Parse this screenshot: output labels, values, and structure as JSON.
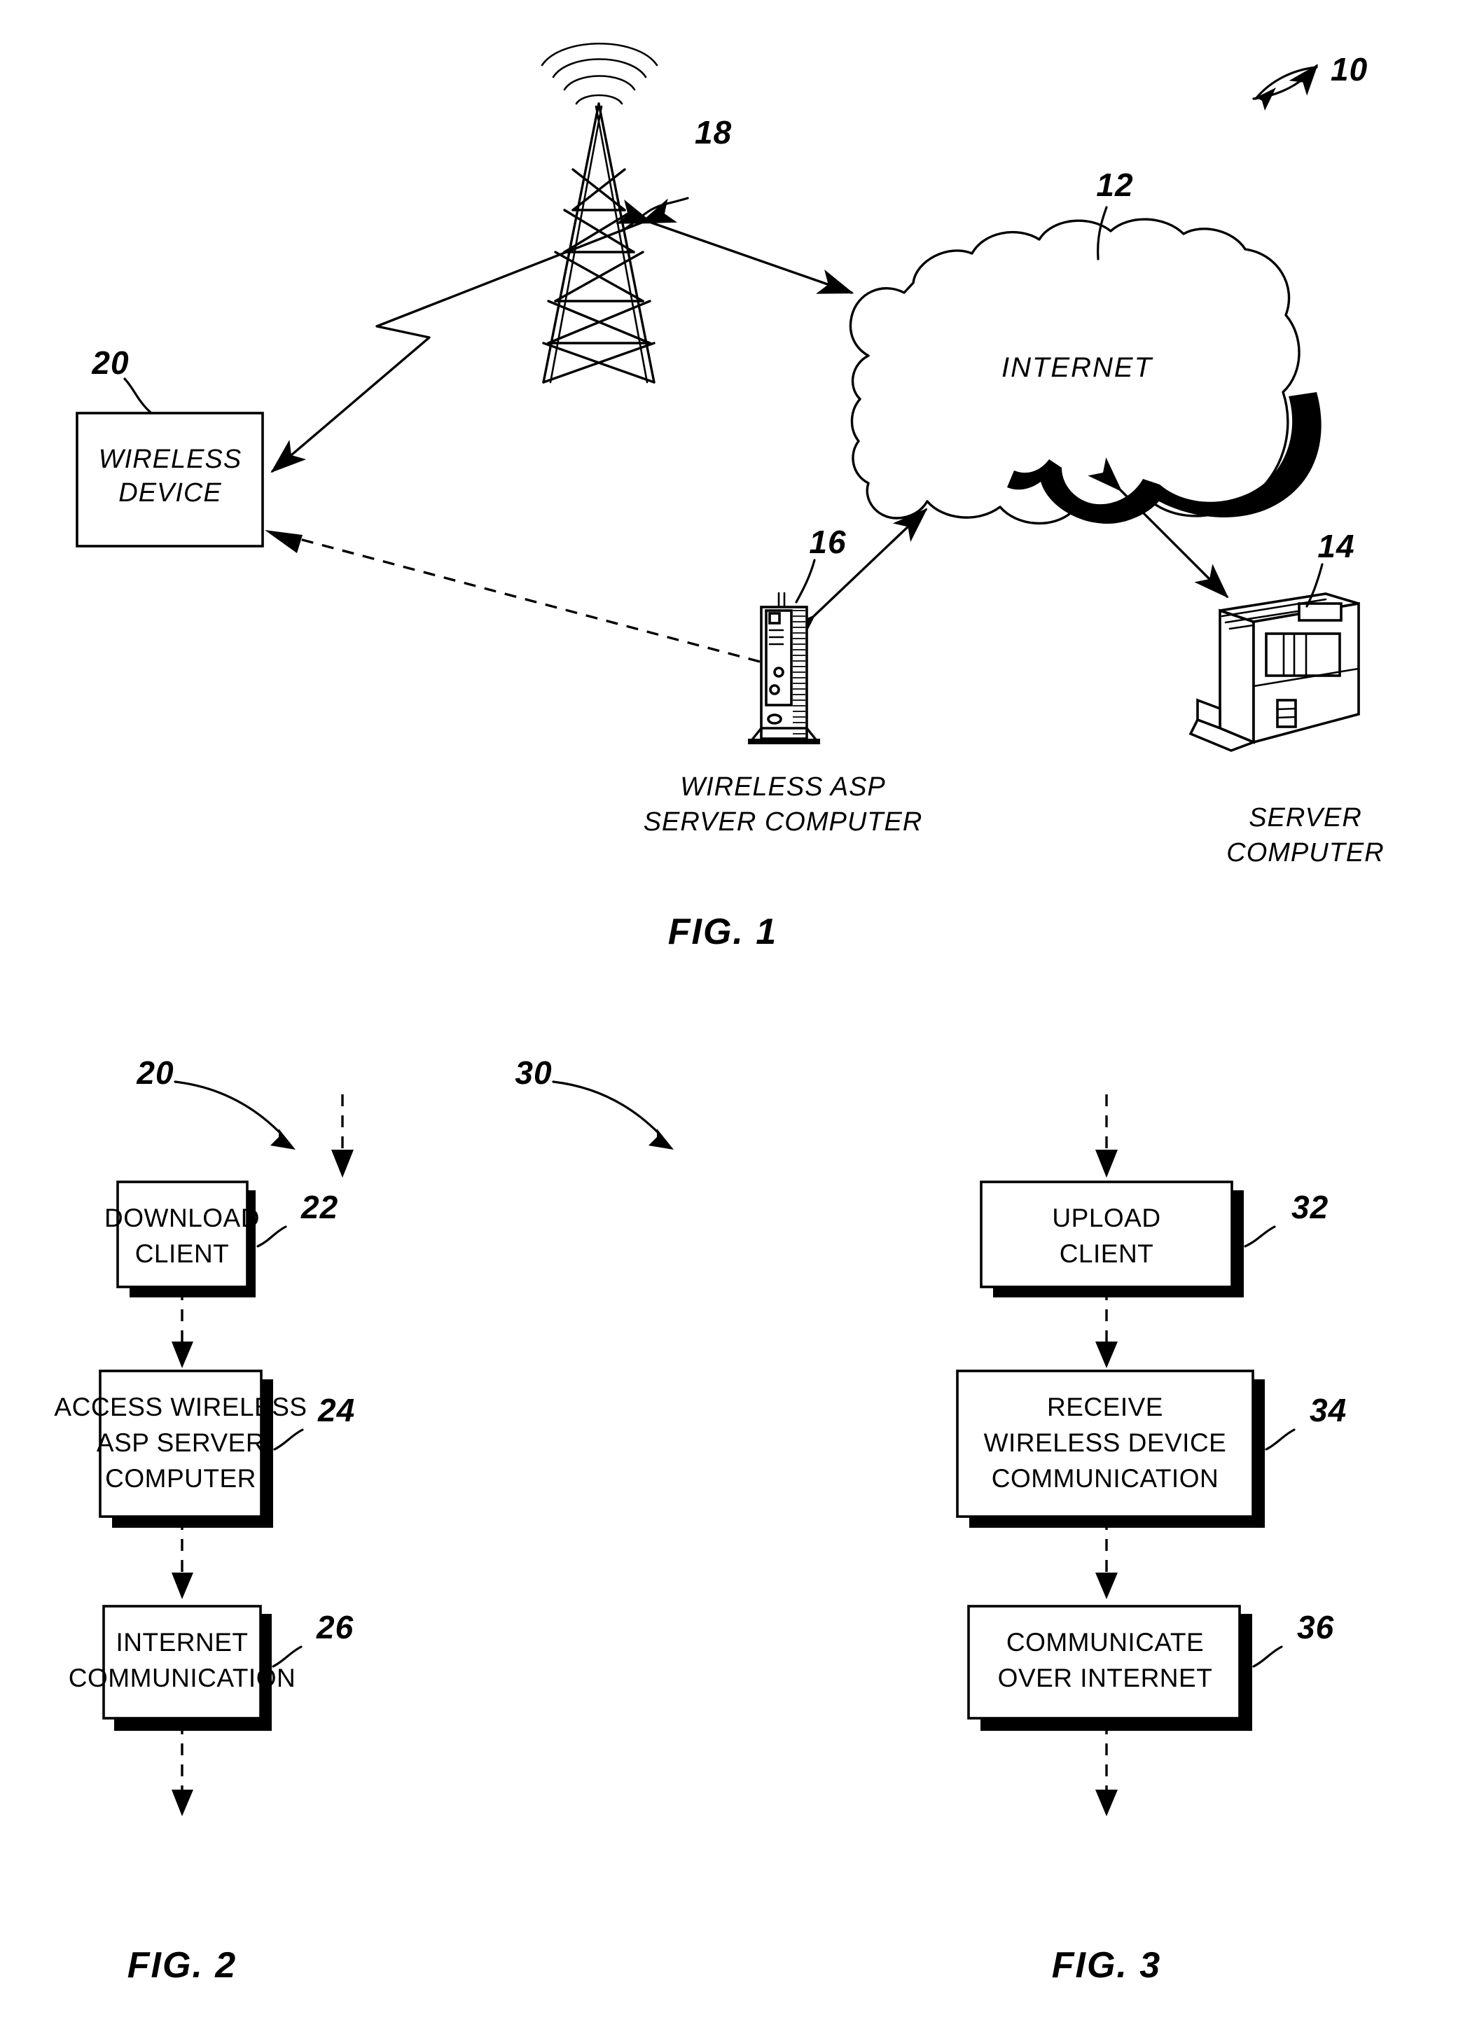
{
  "document": {
    "kind": "patent-drawing-sheet",
    "figures": [
      "FIG. 1",
      "FIG. 2",
      "FIG. 3"
    ]
  },
  "fig1": {
    "caption": "FIG. 1",
    "system_ref": "10",
    "cloud": {
      "label": "INTERNET",
      "ref": "12"
    },
    "tower": {
      "ref": "18"
    },
    "wireless_device": {
      "label_line1": "WIRELESS",
      "label_line2": "DEVICE",
      "ref": "20"
    },
    "asp_server": {
      "label_line1": "WIRELESS ASP",
      "label_line2": "SERVER COMPUTER",
      "ref": "16"
    },
    "server": {
      "label_line1": "SERVER",
      "label_line2": "COMPUTER",
      "ref": "14"
    }
  },
  "fig2": {
    "caption": "FIG. 2",
    "flow_ref": "20",
    "steps": [
      {
        "lines": [
          "DOWNLOAD",
          "CLIENT"
        ],
        "ref": "22"
      },
      {
        "lines": [
          "ACCESS WIRELESS",
          "ASP SERVER",
          "COMPUTER"
        ],
        "ref": "24"
      },
      {
        "lines": [
          "INTERNET",
          "COMMUNICATION"
        ],
        "ref": "26"
      }
    ]
  },
  "fig3": {
    "caption": "FIG. 3",
    "flow_ref": "30",
    "steps": [
      {
        "lines": [
          "UPLOAD",
          "CLIENT"
        ],
        "ref": "32"
      },
      {
        "lines": [
          "RECEIVE",
          "WIRELESS DEVICE",
          "COMMUNICATION"
        ],
        "ref": "34"
      },
      {
        "lines": [
          "COMMUNICATE",
          "OVER INTERNET"
        ],
        "ref": "36"
      }
    ]
  },
  "colors": {
    "ink": "#000000",
    "paper": "#ffffff"
  }
}
